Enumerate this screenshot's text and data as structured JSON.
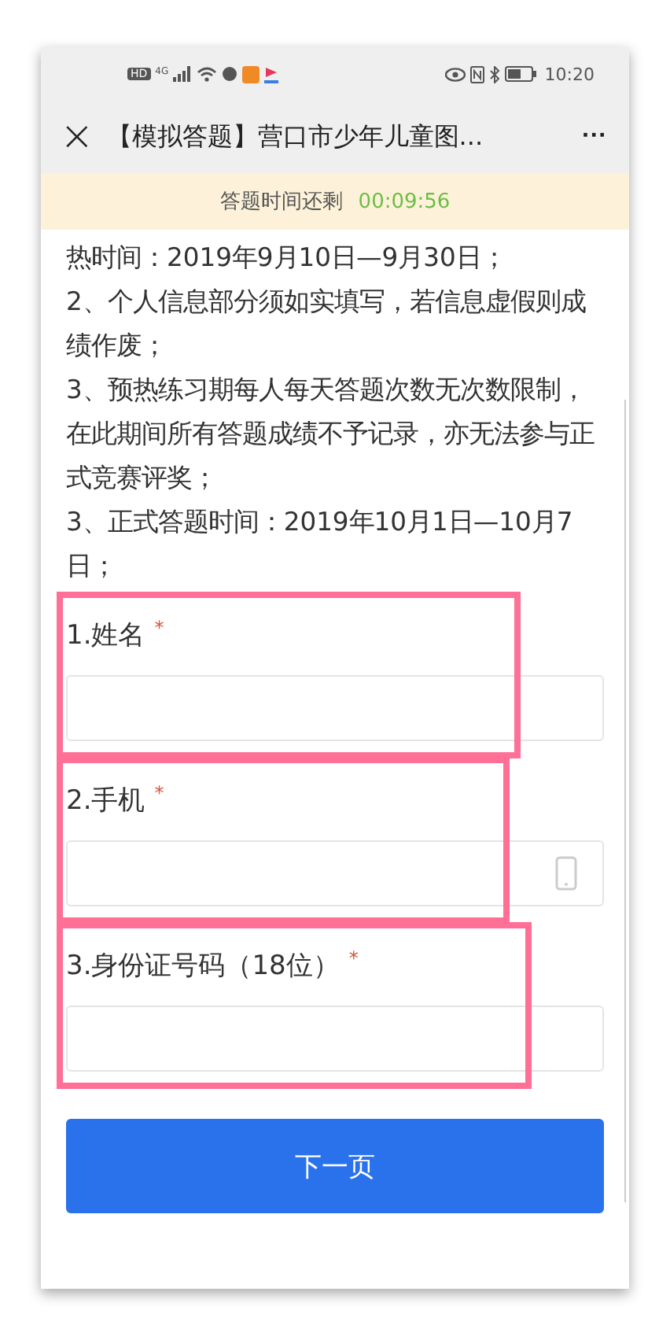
{
  "status_bar": {
    "hd": "HD",
    "network": "4G",
    "time": "10:20"
  },
  "header": {
    "close": "×",
    "title": "【模拟答题】营口市少年儿童图...",
    "more": "···"
  },
  "timer": {
    "label": "答题时间还剩",
    "value": "00:09:56"
  },
  "notes": [
    "热时间：2019年9月10日—9月30日；",
    "2、个人信息部分须如实填写，若信息虚假则成绩作废；",
    "3、预热练习期每人每天答题次数无次数限制，在此期间所有答题成绩不予记录，亦无法参与正式竞赛评奖；",
    "3、正式答题时间：2019年10月1日—10月7日；"
  ],
  "questions": [
    {
      "label": "1.姓名",
      "required_mark": "*",
      "kind": "text",
      "highlighted": true
    },
    {
      "label": "2.手机",
      "required_mark": "*",
      "kind": "phone",
      "highlighted": true
    },
    {
      "label": "3.身份证号码（18位）",
      "required_mark": "*",
      "kind": "text",
      "highlighted": true
    }
  ],
  "next_button": "下一页"
}
